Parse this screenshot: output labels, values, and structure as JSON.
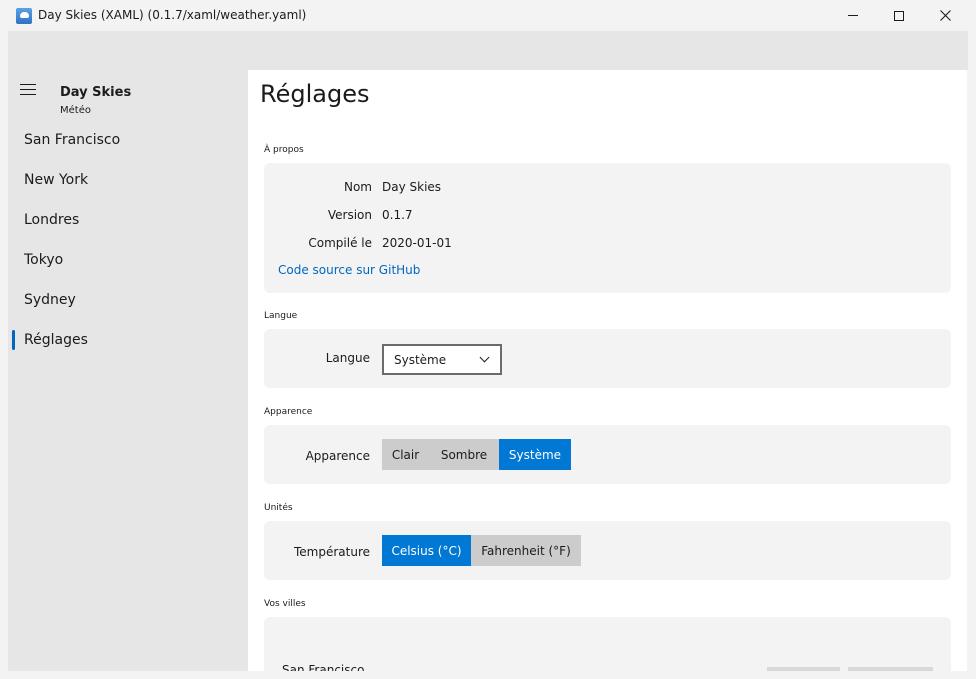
{
  "window": {
    "title": "Day Skies (XAML) (0.1.7/xaml/weather.yaml)",
    "icons": [
      "app-icon",
      "minimize-icon",
      "maximize-icon",
      "close-icon"
    ]
  },
  "sidebar": {
    "app_name": "Day Skies",
    "app_subtitle": "Météo",
    "items": [
      {
        "label": "San Francisco"
      },
      {
        "label": "New York"
      },
      {
        "label": "Londres"
      },
      {
        "label": "Tokyo"
      },
      {
        "label": "Sydney"
      },
      {
        "label": "Réglages",
        "active": true
      }
    ]
  },
  "page": {
    "title": "Réglages",
    "about": {
      "section": "À propos",
      "name_label": "Nom",
      "name_value": "Day Skies",
      "version_label": "Version",
      "version_value": "0.1.7",
      "compiled_label": "Compilé le",
      "compiled_value": "2020-01-01",
      "source_link": "Code source sur GitHub"
    },
    "language": {
      "section": "Langue",
      "label": "Langue",
      "selected": "Système"
    },
    "appearance": {
      "section": "Apparence",
      "label": "Apparence",
      "options": [
        "Clair",
        "Sombre",
        "Système"
      ],
      "selected": "Système"
    },
    "units": {
      "section": "Unités",
      "label": "Température",
      "options": [
        "Celsius (°C)",
        "Fahrenheit (°F)"
      ],
      "selected": "Celsius (°C)"
    },
    "cities": {
      "section": "Vos villes",
      "first_city": "San Francisco"
    }
  },
  "colors": {
    "accent": "#0078d4",
    "link": "#0067c0",
    "sidebar_bg": "#e6e6e6",
    "card_bg": "#f3f3f3"
  }
}
